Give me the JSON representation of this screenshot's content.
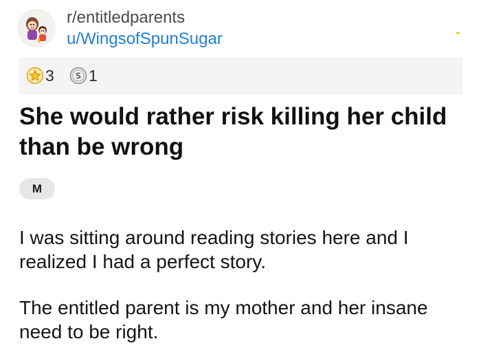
{
  "post": {
    "subreddit": "r/entitledparents",
    "author": "u/WingsofSpunSugar",
    "title": "She would rather risk killing her child than be wrong",
    "flair": "M",
    "paragraphs": [
      "I was sitting around reading stories here and I realized I had a perfect story.",
      "The entitled parent is my mother and her insane need to be right."
    ]
  },
  "awards": [
    {
      "icon": "star-award-icon",
      "count": "3",
      "color": "#f2b824"
    },
    {
      "icon": "silver-coin-icon",
      "count": "1",
      "color": "#8c8c8c"
    }
  ],
  "colors": {
    "username": "#1f7fd6",
    "awards_bar_bg": "#f4f4f4",
    "flair_bg": "#e6e6e6"
  }
}
